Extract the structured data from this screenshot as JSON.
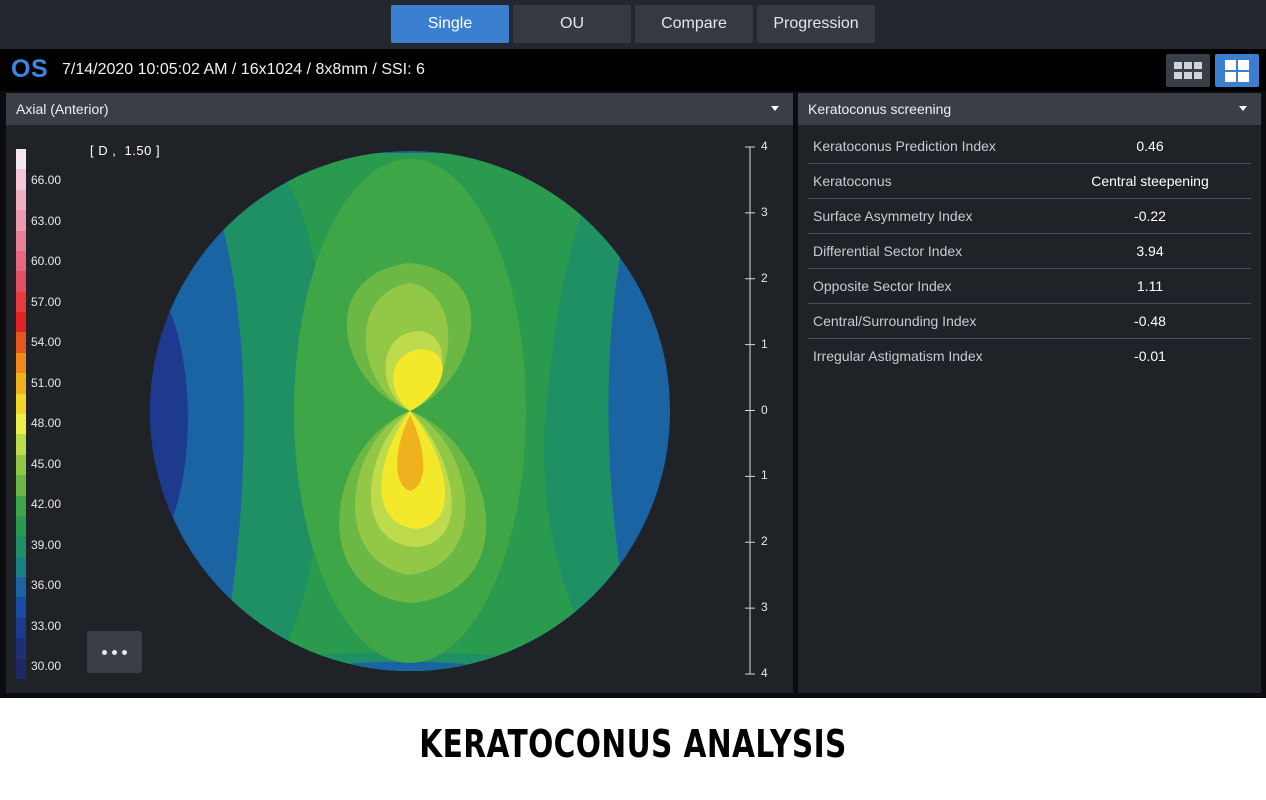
{
  "mode_tabs": [
    {
      "label": "Single",
      "active": true
    },
    {
      "label": "OU",
      "active": false
    },
    {
      "label": "Compare",
      "active": false
    },
    {
      "label": "Progression",
      "active": false
    }
  ],
  "info": {
    "eye": "OS",
    "scan": "7/14/2020 10:05:02 AM / 16x1024 / 8x8mm / SSI: 6",
    "view_icons": [
      "grid-3x2-icon",
      "grid-2x2-icon"
    ]
  },
  "map_panel": {
    "dropdown": "Axial (Anterior)",
    "unit": "[ D ,  1.50 ]",
    "scale_labels": [
      "66.00",
      "63.00",
      "60.00",
      "57.00",
      "54.00",
      "51.00",
      "48.00",
      "45.00",
      "42.00",
      "39.00",
      "36.00",
      "33.00",
      "30.00"
    ],
    "scale_colors": [
      "#f6e6ef",
      "#f3c9d8",
      "#efb0c4",
      "#eb9ab0",
      "#e77f97",
      "#e5687e",
      "#e24e63",
      "#e63a3f",
      "#e02424",
      "#e6571d",
      "#ef8a1d",
      "#f0b11f",
      "#f3d62a",
      "#eef04a",
      "#bddb4c",
      "#93c846",
      "#6cb845",
      "#3fa648",
      "#2a9a4f",
      "#1f8f64",
      "#1b7f86",
      "#1a64a4",
      "#1a4ba2",
      "#1d3a8e",
      "#1e2f78",
      "#1f2862"
    ],
    "ruler_labels": [
      "4",
      "3",
      "2",
      "1",
      "0",
      "1",
      "2",
      "3",
      "4"
    ],
    "more_icon": "more-horizontal-icon"
  },
  "screening_panel": {
    "dropdown": "Keratoconus screening",
    "rows": [
      {
        "name": "Keratoconus Prediction Index",
        "value": "0.46"
      },
      {
        "name": "Keratoconus",
        "value": "Central steepening"
      },
      {
        "name": "Surface Asymmetry Index",
        "value": "-0.22"
      },
      {
        "name": "Differential Sector Index",
        "value": "3.94"
      },
      {
        "name": "Opposite Sector Index",
        "value": "1.11"
      },
      {
        "name": "Central/Surrounding Index",
        "value": "-0.48"
      },
      {
        "name": "Irregular Astigmatism Index",
        "value": "-0.01"
      }
    ]
  },
  "caption": "KERATOCONUS ANALYSIS"
}
